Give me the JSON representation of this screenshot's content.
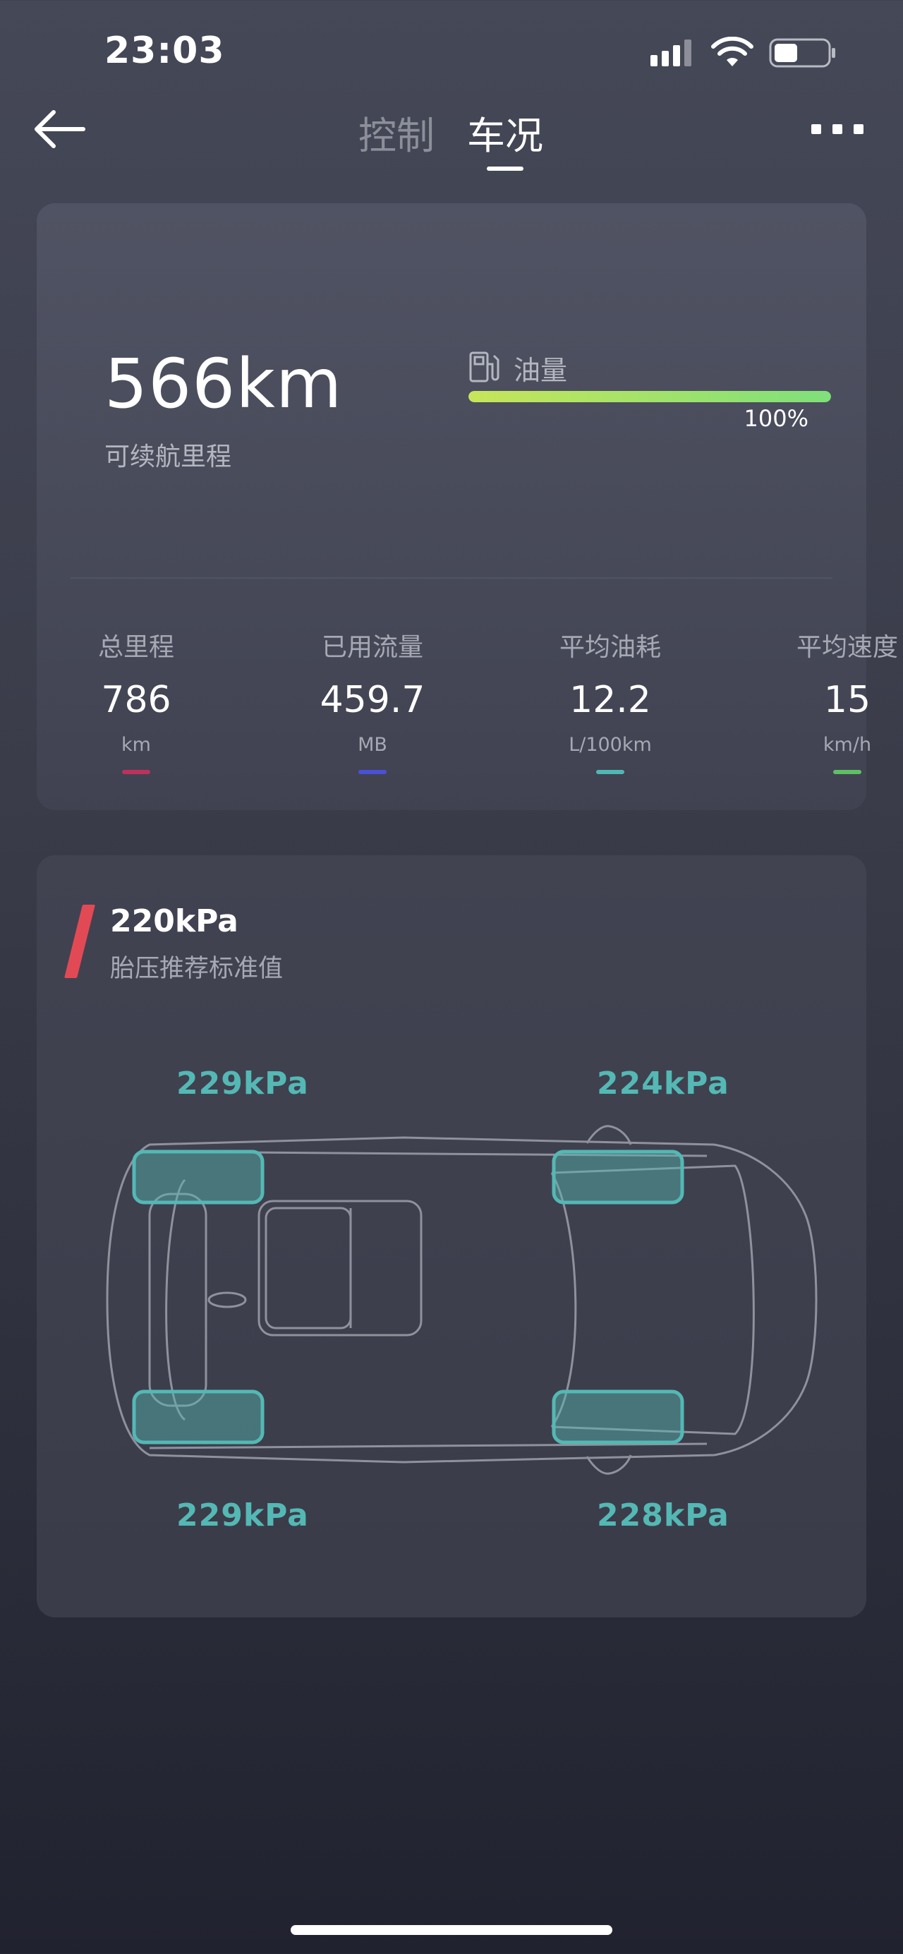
{
  "status_bar": {
    "time": "23:03"
  },
  "nav": {
    "tabs": [
      {
        "label": "控制",
        "active": false
      },
      {
        "label": "车况",
        "active": true
      }
    ]
  },
  "range": {
    "value": "566km",
    "label": "可续航里程",
    "fuel_label": "油量",
    "fuel_percent": "100%",
    "fuel_level": 1.0
  },
  "stats": [
    {
      "label": "总里程",
      "value": "786",
      "unit": "km",
      "color": "#c0305c"
    },
    {
      "label": "已用流量",
      "value": "459.7",
      "unit": "MB",
      "color": "#4b50d8"
    },
    {
      "label": "平均油耗",
      "value": "12.2",
      "unit": "L/100km",
      "color": "#4fb8b4"
    },
    {
      "label": "平均速度",
      "value": "15",
      "unit": "km/h",
      "color": "#5fbf63"
    }
  ],
  "tire": {
    "recommended_value": "220kPa",
    "recommended_label": "胎压推荐标准值",
    "front_left": "229kPa",
    "front_right": "224kPa",
    "rear_left": "229kPa",
    "rear_right": "228kPa",
    "accent_color": "#e14a55",
    "tire_color": "#54b8b4"
  }
}
